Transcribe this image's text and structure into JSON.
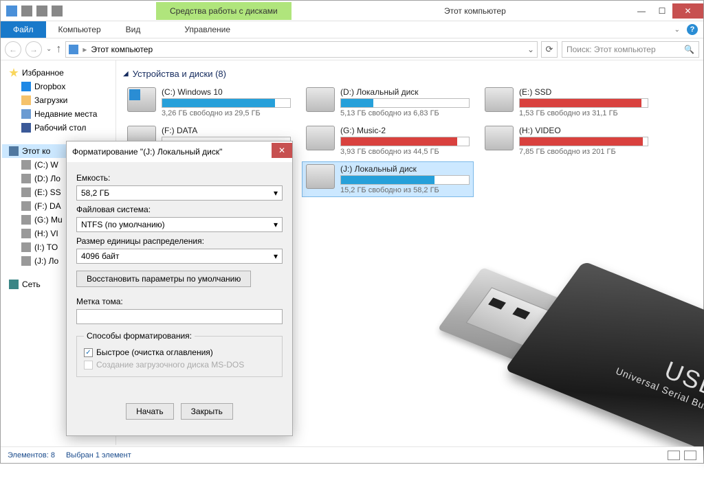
{
  "window": {
    "contextual_tab": "Средства работы с дисками",
    "title": "Этот компьютер"
  },
  "ribbon": {
    "file": "Файл",
    "computer": "Компьютер",
    "view": "Вид",
    "manage": "Управление"
  },
  "navbar": {
    "breadcrumb": "Этот компьютер",
    "search_placeholder": "Поиск: Этот компьютер"
  },
  "sidebar": {
    "favorites": "Избранное",
    "fav_items": [
      "Dropbox",
      "Загрузки",
      "Недавние места",
      "Рабочий стол"
    ],
    "this_pc": "Этот ко",
    "pc_items": [
      "(C:) W",
      "(D:) Ло",
      "(E:) SS",
      "(F:) DA",
      "(G:) Mu",
      "(H:) VI",
      "(I:) TO",
      "(J:) Ло"
    ],
    "network": "Сеть"
  },
  "main": {
    "group_label": "Устройства и диски (8)",
    "drives": [
      {
        "name": "(C:) Windows 10",
        "sub": "3,26 ГБ свободно из 29,5 ГБ",
        "pct": 88,
        "color": "blue",
        "win": true,
        "sel": false
      },
      {
        "name": "(D:) Локальный диск",
        "sub": "5,13 ГБ свободно из 6,83 ГБ",
        "pct": 25,
        "color": "blue",
        "win": false,
        "sel": false
      },
      {
        "name": "(E:) SSD",
        "sub": "1,53 ГБ свободно из 31,1 ГБ",
        "pct": 95,
        "color": "red",
        "win": false,
        "sel": false
      },
      {
        "name": "(F:) DATA",
        "sub": "",
        "pct": 0,
        "color": "blue",
        "win": false,
        "sel": false
      },
      {
        "name": "(G:) Music-2",
        "sub": "3,93 ГБ свободно из 44,5 ГБ",
        "pct": 91,
        "color": "red",
        "win": false,
        "sel": false
      },
      {
        "name": "(H:) VIDEO",
        "sub": "7,85 ГБ свободно из 201 ГБ",
        "pct": 96,
        "color": "red",
        "win": false,
        "sel": false
      },
      {
        "name": "",
        "sub": "",
        "pct": 0,
        "color": "",
        "win": false,
        "sel": false,
        "empty": true
      },
      {
        "name": "(J:) Локальный диск",
        "sub": "15,2 ГБ свободно из 58,2 ГБ",
        "pct": 73,
        "color": "blue",
        "win": false,
        "sel": true
      }
    ]
  },
  "dialog": {
    "title": "Форматирование \"(J:) Локальный диск\"",
    "capacity_label": "Емкость:",
    "capacity_value": "58,2 ГБ",
    "fs_label": "Файловая система:",
    "fs_value": "NTFS (по умолчанию)",
    "alloc_label": "Размер единицы распределения:",
    "alloc_value": "4096 байт",
    "restore_btn": "Восстановить параметры по умолчанию",
    "volume_label": "Метка тома:",
    "volume_value": "",
    "methods_legend": "Способы форматирования:",
    "quick_format": "Быстрое (очистка оглавления)",
    "msdos": "Создание загрузочного диска MS-DOS",
    "start": "Начать",
    "close": "Закрыть"
  },
  "statusbar": {
    "count": "Элементов: 8",
    "selected": "Выбран 1 элемент"
  },
  "usb": {
    "t1": "USB",
    "t2": "Universal Serial Bus"
  }
}
